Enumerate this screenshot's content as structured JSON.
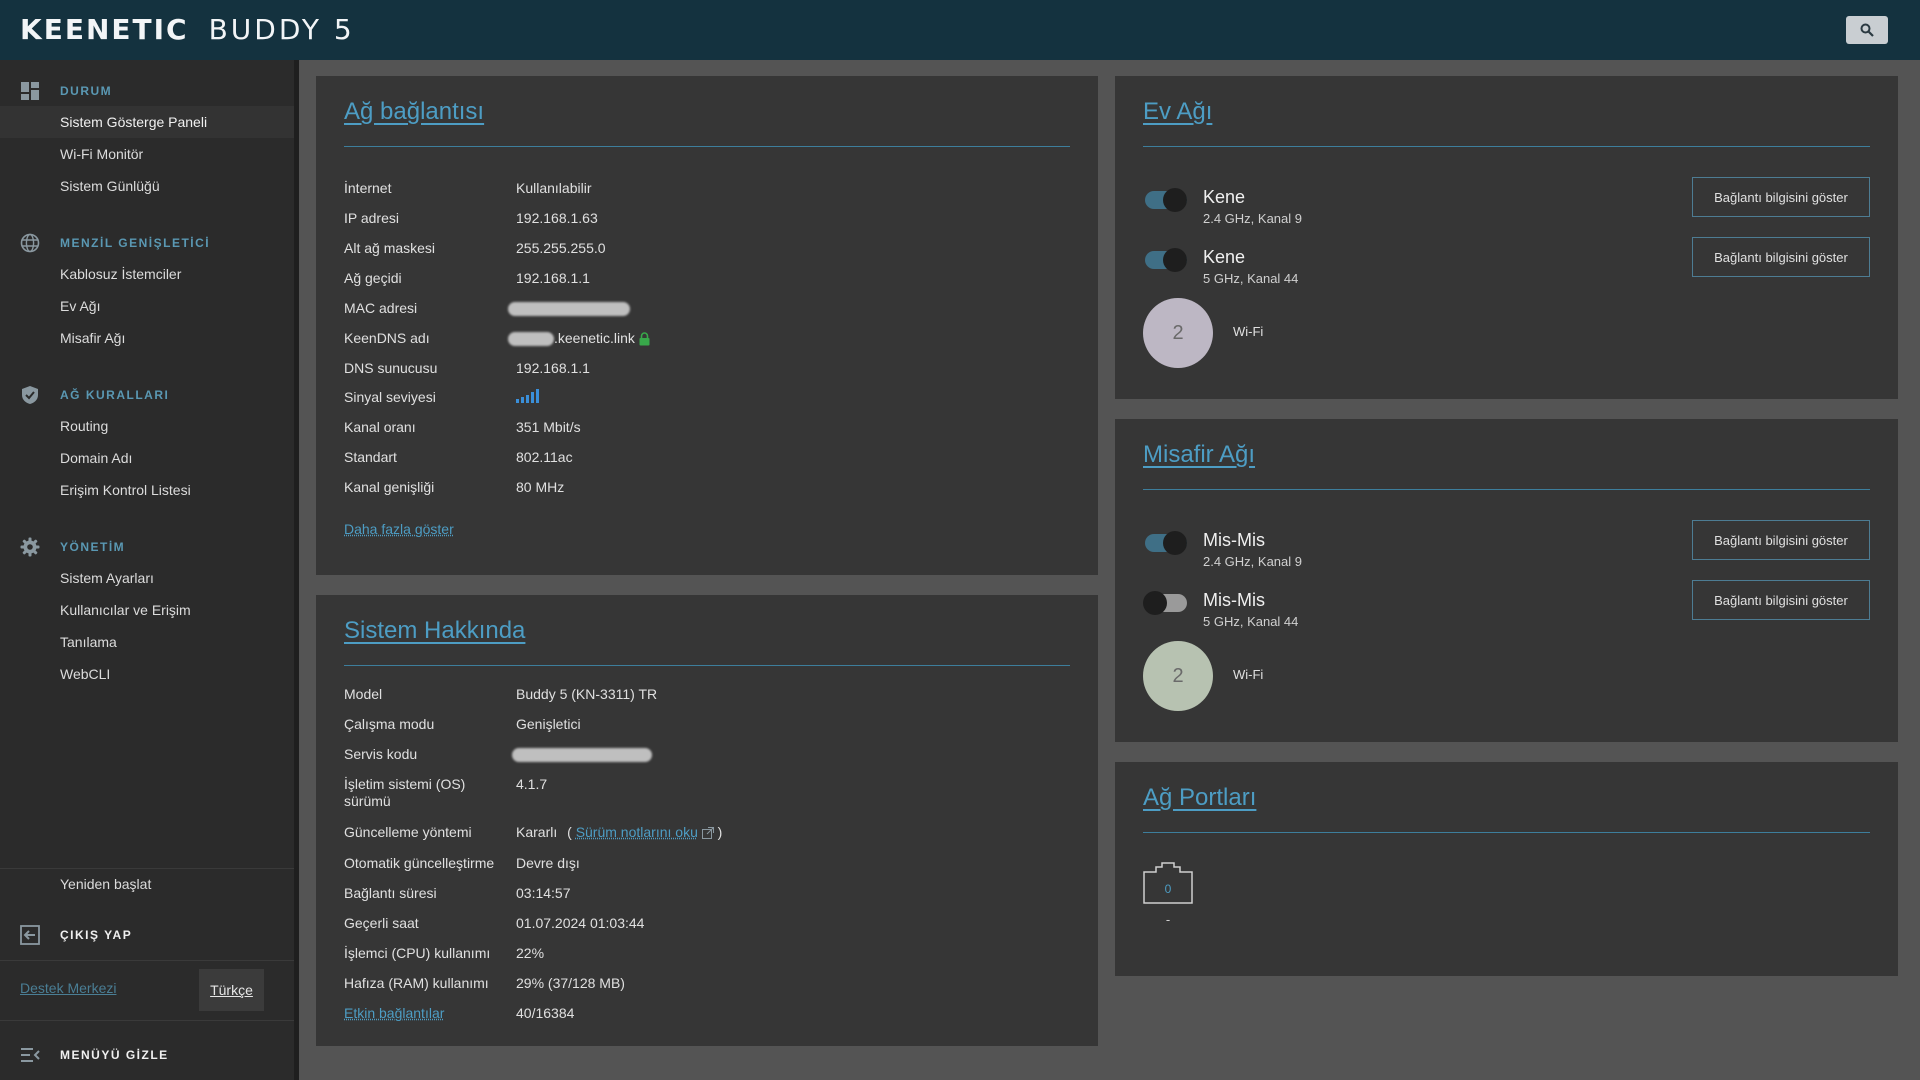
{
  "header": {
    "brand": "KEENETIC",
    "model": "BUDDY 5",
    "search_icon": "search-icon"
  },
  "sidebar": {
    "sections": [
      {
        "title": "DURUM",
        "icon": "dashboard-icon",
        "items": [
          "Sistem Gösterge Paneli",
          "Wi-Fi Monitör",
          "Sistem Günlüğü"
        ]
      },
      {
        "title": "MENZİL GENİŞLETİCİ",
        "icon": "globe-icon",
        "items": [
          "Kablosuz İstemciler",
          "Ev Ağı",
          "Misafir Ağı"
        ]
      },
      {
        "title": "AĞ KURALLARI",
        "icon": "shield-icon",
        "items": [
          "Routing",
          "Domain Adı",
          "Erişim Kontrol Listesi"
        ]
      },
      {
        "title": "YÖNETİM",
        "icon": "gear-icon",
        "items": [
          "Sistem Ayarları",
          "Kullanıcılar ve Erişim",
          "Tanılama",
          "WebCLI"
        ]
      }
    ],
    "restart": "Yeniden başlat",
    "logout": "ÇIKIŞ YAP",
    "support": "Destek Merkezi",
    "language": "Türkçe",
    "hide_menu": "MENÜYÜ GİZLE"
  },
  "network": {
    "title": "Ağ bağlantısı",
    "rows": [
      {
        "key": "İnternet",
        "value": "Kullanılabilir"
      },
      {
        "key": "IP adresi",
        "value": "192.168.1.63"
      },
      {
        "key": "Alt ağ maskesi",
        "value": "255.255.255.0"
      },
      {
        "key": "Ağ geçidi",
        "value": "192.168.1.1"
      },
      {
        "key": "MAC adresi",
        "value": ""
      },
      {
        "key": "KeenDNS adı",
        "value": ".keenetic.link"
      },
      {
        "key": "DNS sunucusu",
        "value": "192.168.1.1"
      },
      {
        "key": "Sinyal seviyesi",
        "value": ""
      },
      {
        "key": "Kanal oranı",
        "value": "351 Mbit/s"
      },
      {
        "key": "Standart",
        "value": "802.11ac"
      },
      {
        "key": "Kanal genişliği",
        "value": "80 MHz"
      }
    ],
    "signal_bars": 5,
    "more": "Daha fazla göster"
  },
  "system": {
    "title": "Sistem Hakkında",
    "rows": [
      {
        "key": "Model",
        "value": "Buddy 5 (KN-3311) TR"
      },
      {
        "key": "Çalışma modu",
        "value": "Genişletici"
      },
      {
        "key": "Servis kodu",
        "value": ""
      },
      {
        "key": "İşletim sistemi (OS) sürümü",
        "value": "4.1.7"
      },
      {
        "key": "Güncelleme yöntemi",
        "value": "Kararlı"
      },
      {
        "key": "Otomatik güncelleştirme",
        "value": "Devre dışı"
      },
      {
        "key": "Bağlantı süresi",
        "value": "03:14:57"
      },
      {
        "key": "Geçerli saat",
        "value": "01.07.2024 01:03:44"
      },
      {
        "key": "İşlemci (CPU) kullanımı",
        "value": "22%"
      },
      {
        "key": "Hafıza (RAM) kullanımı",
        "value": "29% (37/128 MB)"
      },
      {
        "key": "Etkin bağlantılar",
        "value": "40/16384"
      }
    ],
    "release_notes": "Sürüm notlarını oku",
    "paren_open": "(",
    "paren_close": ")"
  },
  "home_network": {
    "title": "Ev Ağı",
    "networks": [
      {
        "name": "Kene",
        "sub": "2.4 GHz, Kanal 9",
        "enabled": true,
        "button": "Bağlantı bilgisini göster"
      },
      {
        "name": "Kene",
        "sub": "5 GHz, Kanal 44",
        "enabled": true,
        "button": "Bağlantı bilgisini göster"
      }
    ],
    "clients": "2",
    "clients_label": "Wi-Fi",
    "circle_color": "#bdb7c4"
  },
  "guest_network": {
    "title": "Misafir Ağı",
    "networks": [
      {
        "name": "Mis-Mis",
        "sub": "2.4 GHz, Kanal 9",
        "enabled": true,
        "button": "Bağlantı bilgisini göster"
      },
      {
        "name": "Mis-Mis",
        "sub": "5 GHz, Kanal 44",
        "enabled": false,
        "button": "Bağlantı bilgisini göster"
      }
    ],
    "clients": "2",
    "clients_label": "Wi-Fi",
    "circle_color": "#b7c2b1"
  },
  "ports": {
    "title": "Ağ Portları",
    "port_number": "0",
    "port_status": "-"
  },
  "colors": {
    "accent": "#4d9dc4",
    "header_bg": "#14323f",
    "sidebar_bg": "#2b2b2b",
    "card_bg": "#363636",
    "page_bg": "#545454",
    "toggle_on": "#3f6f86",
    "toggle_off": "#9a9a9a",
    "lock_green": "#38a84a"
  }
}
